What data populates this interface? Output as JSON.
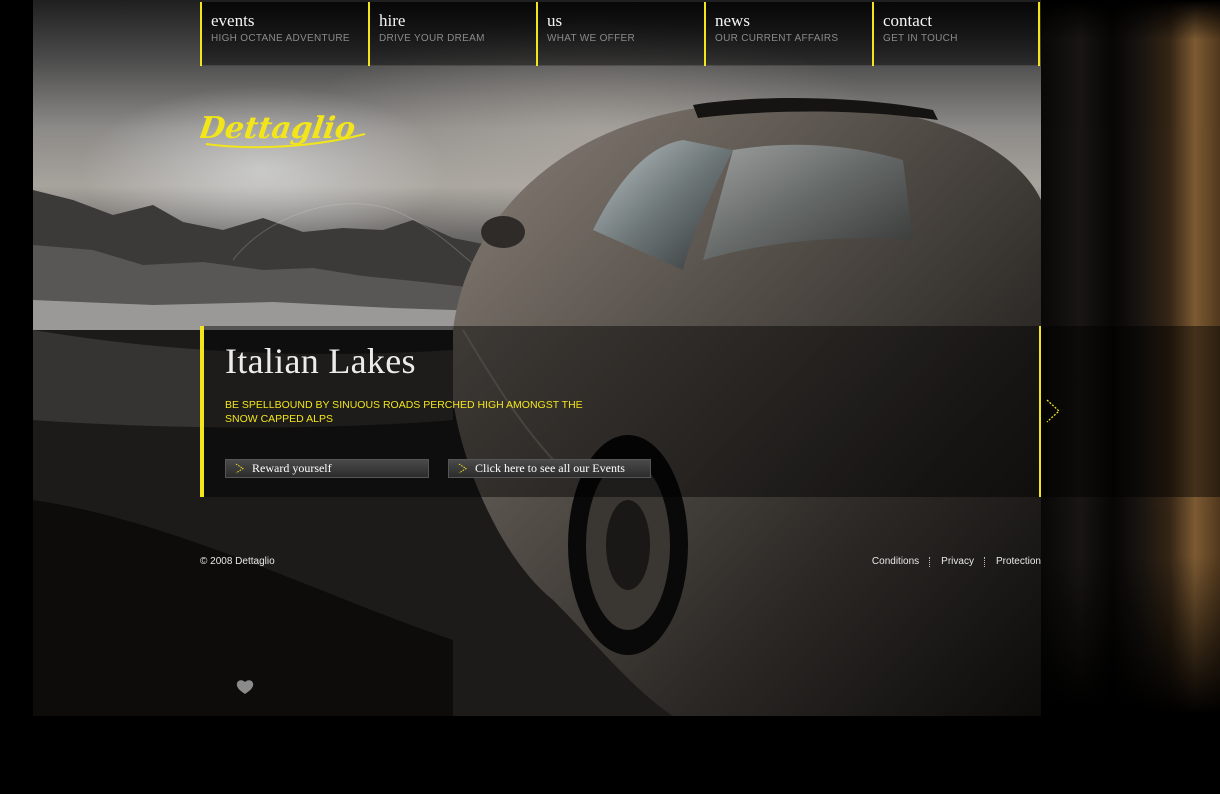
{
  "nav": {
    "items": [
      {
        "title": "events",
        "subtitle": "HIGH OCTANE ADVENTURE"
      },
      {
        "title": "hire",
        "subtitle": "DRIVE YOUR DREAM"
      },
      {
        "title": "us",
        "subtitle": "WHAT WE OFFER"
      },
      {
        "title": "news",
        "subtitle": "OUR CURRENT AFFAIRS"
      },
      {
        "title": "contact",
        "subtitle": "GET IN TOUCH"
      }
    ]
  },
  "brand": {
    "logo_text": "Dettaglio",
    "accent_color": "#f2e51a"
  },
  "feature": {
    "title": "Italian Lakes",
    "description": "BE SPELLBOUND BY SINUOUS ROADS PERCHED HIGH AMONGST THE SNOW CAPPED ALPS",
    "buttons": {
      "reward": "Reward yourself",
      "events": "Click here to see all our Events"
    },
    "next_icon": "chevron-right-icon"
  },
  "footer": {
    "copyright": "© 2008 Dettaglio",
    "links": [
      "Conditions",
      "Privacy",
      "Protection"
    ]
  }
}
